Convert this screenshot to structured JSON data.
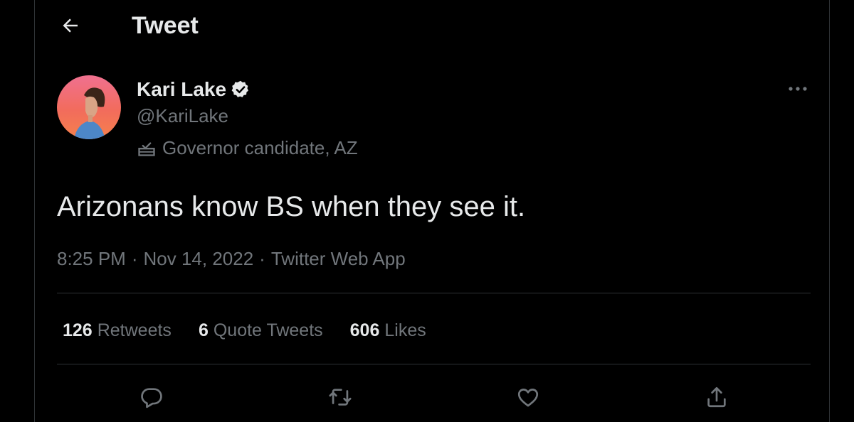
{
  "header": {
    "title": "Tweet",
    "back_icon": "arrow-left-icon"
  },
  "author": {
    "display_name": "Kari Lake",
    "handle": "@KariLake",
    "verified": true,
    "label": "Governor candidate, AZ",
    "label_icon": "ballot-box-icon"
  },
  "tweet": {
    "text": "Arizonans know BS when they see it.",
    "time": "8:25 PM",
    "date": "Nov 14, 2022",
    "source": "Twitter Web App",
    "separator": "·"
  },
  "stats": {
    "retweets": {
      "count": "126",
      "label": "Retweets"
    },
    "quotes": {
      "count": "6",
      "label": "Quote Tweets"
    },
    "likes": {
      "count": "606",
      "label": "Likes"
    }
  },
  "actions": [
    "reply-icon",
    "retweet-icon",
    "like-icon",
    "share-icon"
  ],
  "colors": {
    "background": "#000000",
    "primary_text": "#e7e9ea",
    "secondary_text": "#71767b",
    "border": "#2f3336"
  }
}
